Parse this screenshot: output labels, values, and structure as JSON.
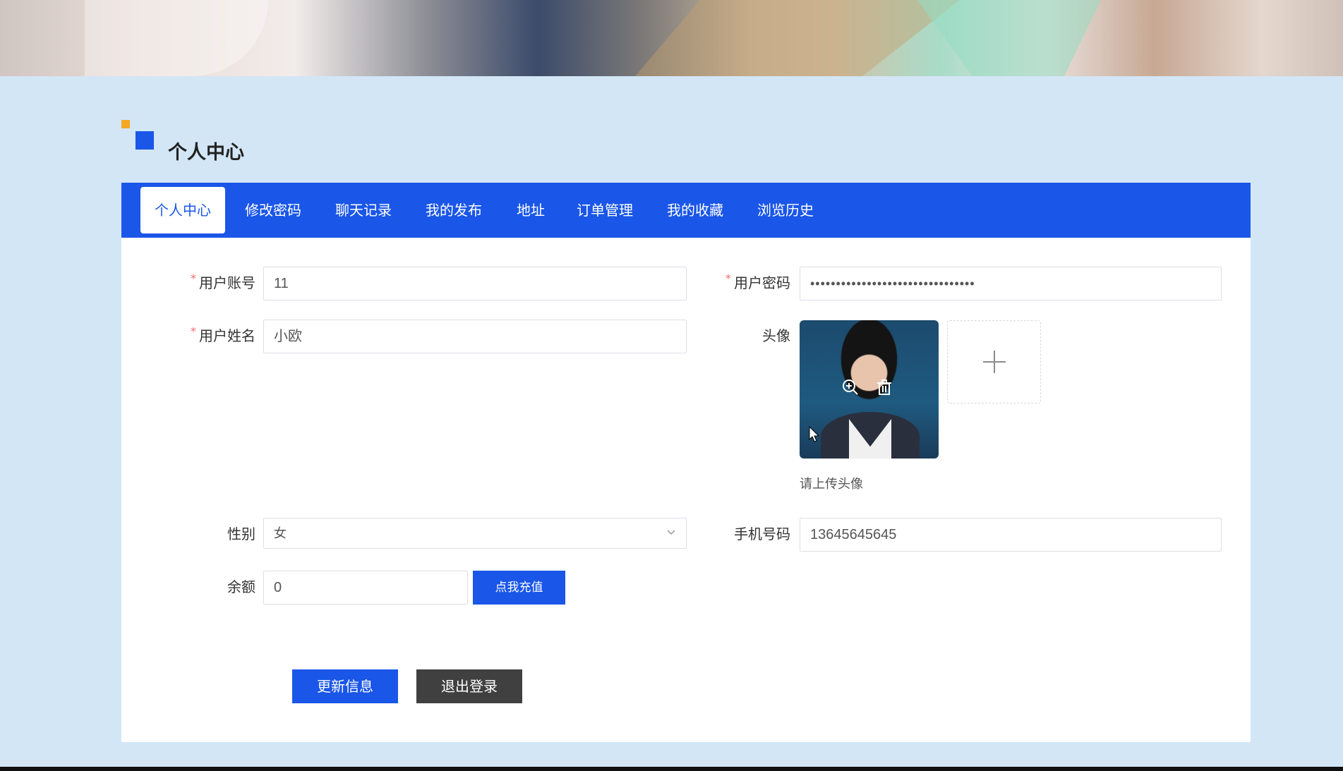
{
  "section": {
    "title": "个人中心"
  },
  "tabs": [
    {
      "label": "个人中心"
    },
    {
      "label": "修改密码"
    },
    {
      "label": "聊天记录"
    },
    {
      "label": "我的发布"
    },
    {
      "label": "地址"
    },
    {
      "label": "订单管理"
    },
    {
      "label": "我的收藏"
    },
    {
      "label": "浏览历史"
    }
  ],
  "form": {
    "account": {
      "label": "用户账号",
      "value": "11",
      "required": "*"
    },
    "password": {
      "label": "用户密码",
      "value": "••••••••••••••••••••••••••••••••",
      "required": "*"
    },
    "name": {
      "label": "用户姓名",
      "value": "小欧",
      "required": "*"
    },
    "avatar": {
      "label": "头像",
      "hint": "请上传头像"
    },
    "gender": {
      "label": "性别",
      "value": "女"
    },
    "phone": {
      "label": "手机号码",
      "value": "13645645645"
    },
    "balance": {
      "label": "余额",
      "value": "0",
      "recharge_label": "点我充值"
    }
  },
  "actions": {
    "update_label": "更新信息",
    "logout_label": "退出登录"
  },
  "colors": {
    "primary": "#1a56e8",
    "accent": "#f5a623",
    "background": "#d3e6f6",
    "logout": "#404040"
  },
  "icons": {
    "zoom": "zoom-in-icon",
    "delete": "trash-icon",
    "add": "plus-icon",
    "dropdown": "chevron-down-icon"
  }
}
